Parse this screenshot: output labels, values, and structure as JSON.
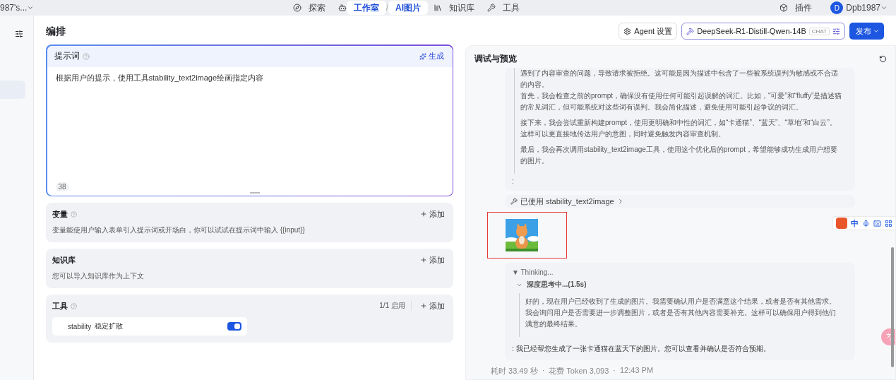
{
  "top_nav": {
    "workspace": "987's...",
    "items": [
      {
        "label": "探索",
        "selected": false
      },
      {
        "label": "工作室",
        "selected": true
      },
      {
        "label": "知识库",
        "selected": false
      },
      {
        "label": "工具",
        "selected": false
      }
    ],
    "breadcrumb_separator": "/",
    "breadcrumb": "AI图片",
    "plugins": "插件",
    "user": {
      "avatar": "D",
      "name": "Dpb1987"
    }
  },
  "editor": {
    "title": "编排",
    "prompt": {
      "label": "提示词",
      "generate": "生成",
      "value": "根据用户的提示，使用工具stability_text2image绘画指定内容",
      "count": "38"
    },
    "sections": [
      {
        "title": "变量",
        "help": true,
        "action": "添加",
        "description": "变量能使用户输入表单引入提示词或开场白，你可以试试在提示词中输入 {{input}}"
      },
      {
        "title": "知识库",
        "help": false,
        "action": "添加",
        "description": "您可以导入知识库作为上下文"
      },
      {
        "title": "工具",
        "help": true,
        "status": "1/1 启用",
        "action": "添加",
        "tools": [
          {
            "name": "stability",
            "description": "稳定扩散",
            "on": true
          }
        ]
      }
    ]
  },
  "header_actions": {
    "agent_settings": "Agent 设置",
    "model": {
      "name": "DeepSeek-R1-Distill-Qwen-14B",
      "tag": "CHAT"
    },
    "publish": "发布"
  },
  "preview": {
    "title": "调试与预览",
    "reasoning": [
      "遇到了内容审查的问题，导致请求被拒绝。这可能是因为描述中包含了一些被系统误判为敏感或不合适的内容。",
      "首先，我会检查之前的prompt，确保没有使用任何可能引起误解的词汇。比如，“可爱”和“fluffy”是描述猫的常见词汇，但可能系统对这些词有误判。我会简化描述，避免使用可能引起争议的词汇。",
      "接下来，我会尝试重新构建prompt，使用更明确和中性的词汇，如“卡通猫”、“蓝天”、“草地”和“白云”。这样可以更直接地传达用户的意图，同时避免触发内容审查机制。",
      "最后，我会再次调用stability_text2image工具，使用这个优化后的prompt，希望能够成功生成用户想要的图片。"
    ],
    "colon": ":",
    "tool_used": "已使用 stability_text2image",
    "image": {
      "kind": "picture",
      "highlighted": true
    },
    "thinking": {
      "label": "▼ Thinking...",
      "step": "深度思考中...(1.5s)",
      "text": "好的，现在用户已经收到了生成的图片。我需要确认用户是否满意这个结果，或者是否有其他需求。我会询问用户是否需要进一步调整图片，或者是否有其他内容需要补充。这样可以确保用户得到他们满意的最终结果。"
    },
    "answer": ": 我已经帮您生成了一张卡通猫在蓝天下的图片。您可以查看并确认是否符合预期。",
    "meta": [
      "耗时 33.49 秒",
      "花费 Token 3,093",
      "12:43 PM"
    ],
    "meta_separator": "·"
  },
  "ime_toolbar": {
    "mode": "中"
  }
}
